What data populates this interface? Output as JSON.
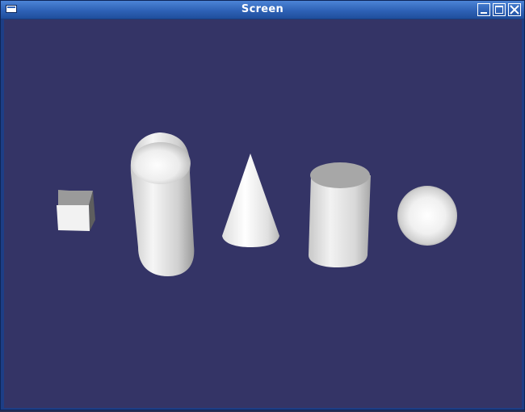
{
  "window": {
    "title": "Screen",
    "controls": [
      "minimize",
      "maximize",
      "close"
    ],
    "icon": "window-menu-icon"
  },
  "scene": {
    "background_color": "#343466",
    "objects": [
      {
        "name": "cube",
        "color": "#eaeaea"
      },
      {
        "name": "capsule",
        "color": "#eaeaea"
      },
      {
        "name": "cone",
        "color": "#eaeaea"
      },
      {
        "name": "cylinder",
        "color": "#eaeaea"
      },
      {
        "name": "sphere",
        "color": "#eaeaea"
      }
    ]
  }
}
